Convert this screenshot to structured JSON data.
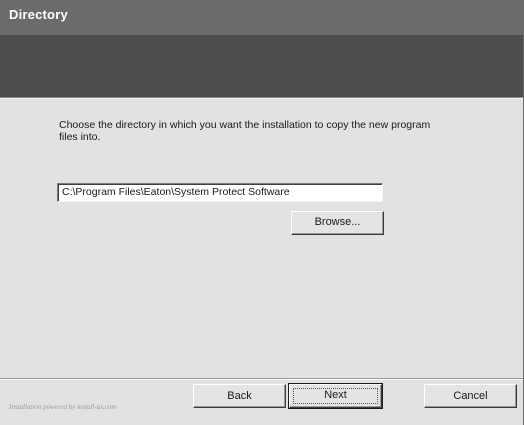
{
  "window": {
    "title": "Directory"
  },
  "content": {
    "instruction": "Choose the directory in which you want the installation to copy the new program files into.",
    "install_path": "C:\\Program Files\\Eaton\\System Protect Software",
    "browse_label": "Browse..."
  },
  "footer": {
    "brand": "Installation powered by install-us.com",
    "back_label": "Back",
    "next_label": "Next",
    "cancel_label": "Cancel"
  }
}
